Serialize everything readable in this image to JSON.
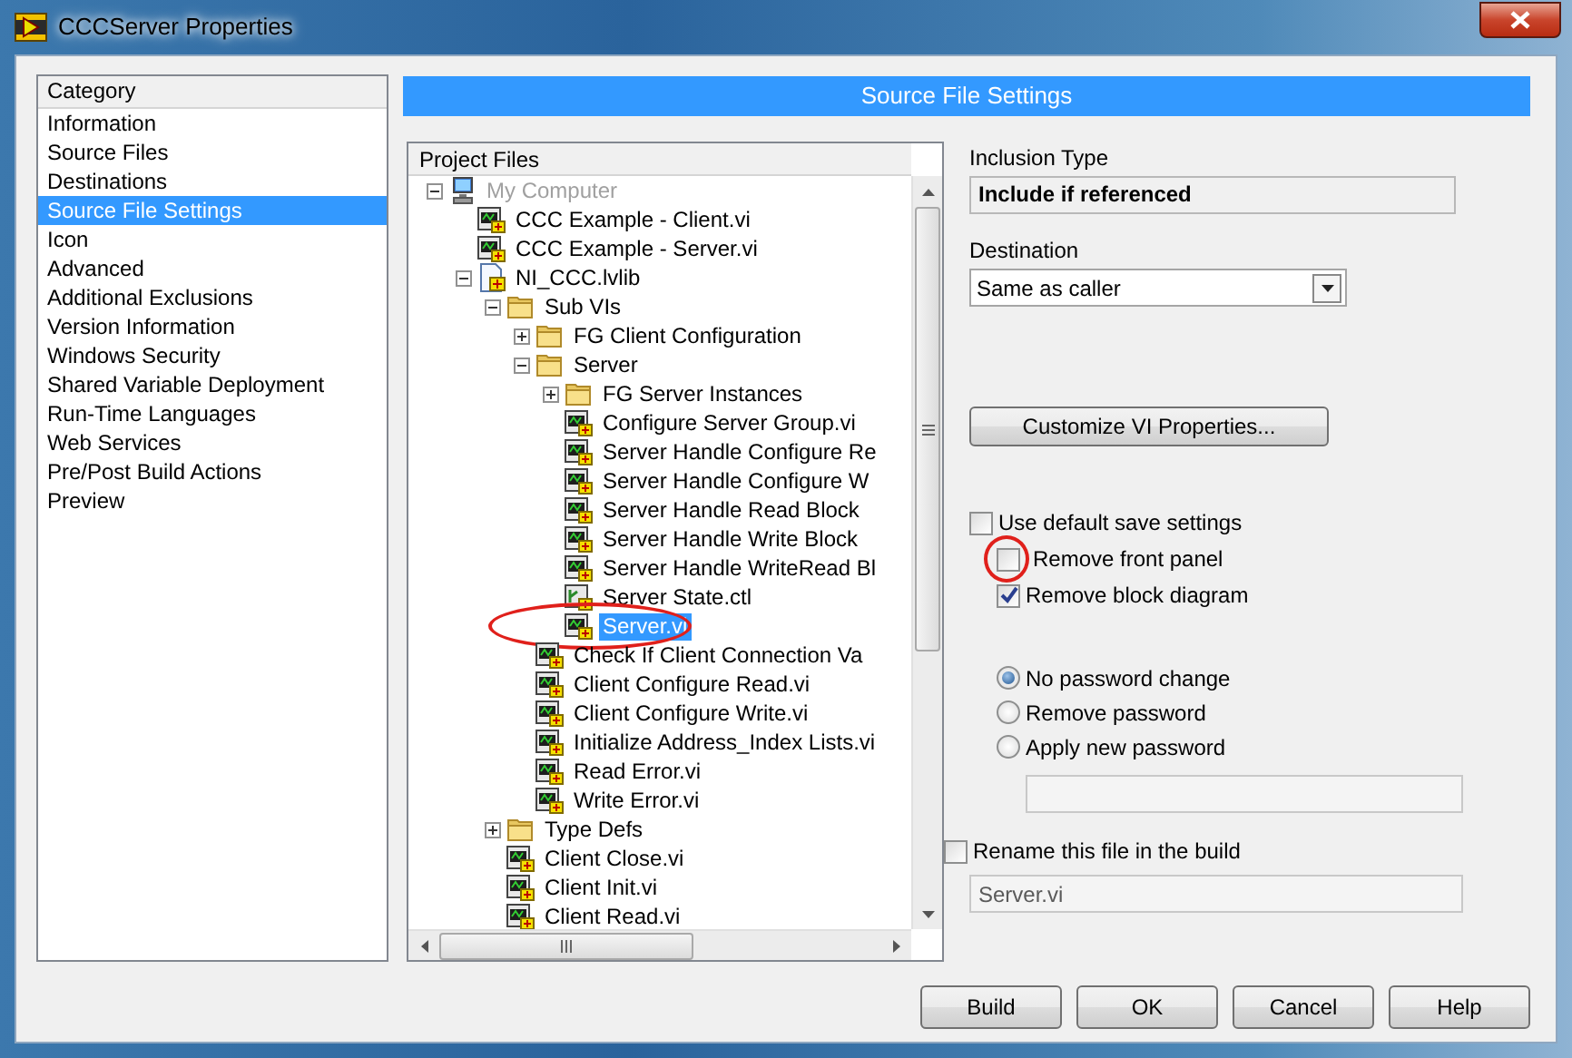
{
  "window": {
    "title": "CCCServer Properties"
  },
  "category": {
    "heading": "Category",
    "items": [
      {
        "label": "Information",
        "selected": false
      },
      {
        "label": "Source Files",
        "selected": false
      },
      {
        "label": "Destinations",
        "selected": false
      },
      {
        "label": "Source File Settings",
        "selected": true
      },
      {
        "label": "Icon",
        "selected": false
      },
      {
        "label": "Advanced",
        "selected": false
      },
      {
        "label": "Additional Exclusions",
        "selected": false
      },
      {
        "label": "Version Information",
        "selected": false
      },
      {
        "label": "Windows Security",
        "selected": false
      },
      {
        "label": "Shared Variable Deployment",
        "selected": false
      },
      {
        "label": "Run-Time Languages",
        "selected": false
      },
      {
        "label": "Web Services",
        "selected": false
      },
      {
        "label": "Pre/Post Build Actions",
        "selected": false
      },
      {
        "label": "Preview",
        "selected": false
      }
    ]
  },
  "section_title": "Source File Settings",
  "project_files": {
    "heading": "Project Files",
    "tree": [
      {
        "label": "My Computer",
        "kind": "computer",
        "expanded": true,
        "selected": false,
        "disabled": true,
        "circled": false,
        "children": [
          {
            "label": "CCC Example - Client.vi",
            "kind": "vi",
            "selected": false,
            "disabled": false,
            "circled": false
          },
          {
            "label": "CCC Example - Server.vi",
            "kind": "vi",
            "selected": false,
            "disabled": false,
            "circled": false
          },
          {
            "label": "NI_CCC.lvlib",
            "kind": "library",
            "expanded": true,
            "selected": false,
            "disabled": false,
            "circled": false,
            "children": [
              {
                "label": "Sub VIs",
                "kind": "folder",
                "expanded": true,
                "selected": false,
                "disabled": false,
                "circled": false,
                "children": [
                  {
                    "label": "FG Client Configuration",
                    "kind": "folder",
                    "expanded": false,
                    "selected": false,
                    "disabled": false,
                    "circled": false
                  },
                  {
                    "label": "Server",
                    "kind": "folder",
                    "expanded": true,
                    "selected": false,
                    "disabled": false,
                    "circled": false,
                    "children": [
                      {
                        "label": "FG Server Instances",
                        "kind": "folder",
                        "expanded": false,
                        "selected": false,
                        "disabled": false,
                        "circled": false
                      },
                      {
                        "label": "Configure Server Group.vi",
                        "kind": "vi",
                        "selected": false,
                        "disabled": false,
                        "circled": false
                      },
                      {
                        "label": "Server Handle Configure Re",
                        "kind": "vi",
                        "selected": false,
                        "disabled": false,
                        "circled": false
                      },
                      {
                        "label": "Server Handle Configure W",
                        "kind": "vi",
                        "selected": false,
                        "disabled": false,
                        "circled": false
                      },
                      {
                        "label": "Server Handle Read Block",
                        "kind": "vi",
                        "selected": false,
                        "disabled": false,
                        "circled": false
                      },
                      {
                        "label": "Server Handle Write Block",
                        "kind": "vi",
                        "selected": false,
                        "disabled": false,
                        "circled": false
                      },
                      {
                        "label": "Server Handle WriteRead Bl",
                        "kind": "vi",
                        "selected": false,
                        "disabled": false,
                        "circled": false
                      },
                      {
                        "label": "Server State.ctl",
                        "kind": "control",
                        "selected": false,
                        "disabled": false,
                        "circled": false
                      },
                      {
                        "label": "Server.vi",
                        "kind": "vi",
                        "selected": true,
                        "disabled": false,
                        "circled": true
                      }
                    ]
                  },
                  {
                    "label": "Check If Client Connection Va",
                    "kind": "vi",
                    "selected": false,
                    "disabled": false,
                    "circled": false
                  },
                  {
                    "label": "Client Configure Read.vi",
                    "kind": "vi",
                    "selected": false,
                    "disabled": false,
                    "circled": false
                  },
                  {
                    "label": "Client Configure Write.vi",
                    "kind": "vi",
                    "selected": false,
                    "disabled": false,
                    "circled": false
                  },
                  {
                    "label": "Initialize Address_Index Lists.vi",
                    "kind": "vi",
                    "selected": false,
                    "disabled": false,
                    "circled": false
                  },
                  {
                    "label": "Read Error.vi",
                    "kind": "vi",
                    "selected": false,
                    "disabled": false,
                    "circled": false
                  },
                  {
                    "label": "Write Error.vi",
                    "kind": "vi",
                    "selected": false,
                    "disabled": false,
                    "circled": false
                  }
                ]
              },
              {
                "label": "Type Defs",
                "kind": "folder",
                "expanded": false,
                "selected": false,
                "disabled": false,
                "circled": false
              },
              {
                "label": "Client Close.vi",
                "kind": "vi",
                "selected": false,
                "disabled": false,
                "circled": false
              },
              {
                "label": "Client Init.vi",
                "kind": "vi",
                "selected": false,
                "disabled": false,
                "circled": false
              },
              {
                "label": "Client Read.vi",
                "kind": "vi",
                "selected": false,
                "disabled": false,
                "circled": false
              }
            ]
          }
        ]
      }
    ]
  },
  "inclusion_type": {
    "label": "Inclusion Type",
    "value": "Include if referenced"
  },
  "destination": {
    "label": "Destination",
    "value": "Same as caller"
  },
  "customize_button": "Customize VI Properties...",
  "save_settings": {
    "label": "Use default save settings",
    "checked": false,
    "circled": false,
    "children": [
      {
        "label": "Remove front panel",
        "checked": false,
        "circled": true
      },
      {
        "label": "Remove block diagram",
        "checked": true,
        "circled": false
      }
    ]
  },
  "password_options": [
    {
      "label": "No password change",
      "selected": true
    },
    {
      "label": "Remove password",
      "selected": false
    },
    {
      "label": "Apply new password",
      "selected": false
    }
  ],
  "password_field": {
    "disabled": true
  },
  "rename": {
    "label": "Rename this file in the build",
    "checked": false,
    "field": {
      "value": "Server.vi",
      "disabled": true
    }
  },
  "buttons": [
    "Build",
    "OK",
    "Cancel",
    "Help"
  ]
}
